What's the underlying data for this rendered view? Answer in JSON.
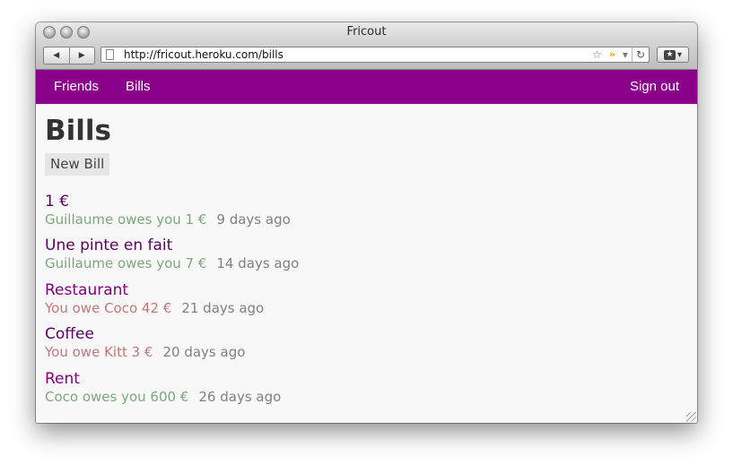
{
  "window": {
    "title": "Fricout"
  },
  "toolbar": {
    "back_icon": "back-arrow-icon",
    "forward_icon": "forward-arrow-icon",
    "url": "http://fricout.heroku.com/bills",
    "bookmark_icon": "star-icon",
    "rss_icon": "rss-icon",
    "dropdown_icon": "chevron-down-icon",
    "reload_icon": "reload-icon",
    "bookmarks_menu_icon": "bookmarks-icon"
  },
  "nav": {
    "brand_color": "#8b008b",
    "items": [
      {
        "label": "Friends"
      },
      {
        "label": "Bills"
      }
    ],
    "sign_out": "Sign out"
  },
  "page": {
    "title": "Bills",
    "new_bill_label": "New Bill"
  },
  "colors": {
    "owes_you": "#7aa97a",
    "you_owe": "#c07878",
    "link": "#800080"
  },
  "bills": [
    {
      "title": "1 €",
      "summary": "Guillaume owes you 1 €",
      "direction": "owes_you",
      "ago": "9 days ago"
    },
    {
      "title": "Une pinte en fait",
      "summary": "Guillaume owes you 7 €",
      "direction": "owes_you",
      "ago": "14 days ago"
    },
    {
      "title": "Restaurant",
      "summary": "You owe Coco 42 €",
      "direction": "you_owe",
      "ago": "21 days ago"
    },
    {
      "title": "Coffee",
      "summary": "You owe Kitt 3 €",
      "direction": "you_owe",
      "ago": "20 days ago"
    },
    {
      "title": "Rent",
      "summary": "Coco owes you 600 €",
      "direction": "owes_you",
      "ago": "26 days ago"
    }
  ]
}
